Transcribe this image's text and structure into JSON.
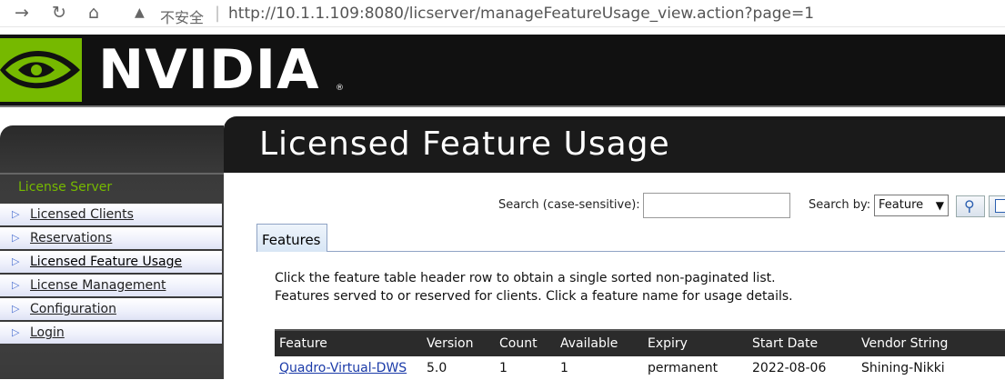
{
  "browser": {
    "back_icon": "arrow-right-icon",
    "insecure_label": "不安全",
    "url": "http://10.1.1.109:8080/licserver/manageFeatureUsage_view.action?page=1"
  },
  "brand": {
    "name": "NVIDIA",
    "registered": "®",
    "accent": "#76b900"
  },
  "sidebar": {
    "section_title": "License Server",
    "items": [
      {
        "label": "Licensed Clients"
      },
      {
        "label": "Reservations"
      },
      {
        "label": "Licensed Feature Usage"
      },
      {
        "label": "License Management"
      },
      {
        "label": "Configuration"
      },
      {
        "label": "Login"
      }
    ]
  },
  "main": {
    "title": "Licensed Feature Usage",
    "search_label": "Search (case-sensitive):",
    "search_value": "",
    "search_by_label": "Search by:",
    "search_by_value": "Feature",
    "tab_label": "Features",
    "description_1": "Click the feature table header row to obtain a single sorted non-paginated list.",
    "description_2": "Features served to or reserved for clients. Click a feature name for usage details."
  },
  "table": {
    "columns": [
      "Feature",
      "Version",
      "Count",
      "Available",
      "Expiry",
      "Start Date",
      "Vendor String"
    ],
    "rows": [
      [
        "Quadro-Virtual-DWS",
        "5.0",
        "1",
        "1",
        "permanent",
        "2022-08-06",
        "Shining-Nikki"
      ]
    ]
  }
}
